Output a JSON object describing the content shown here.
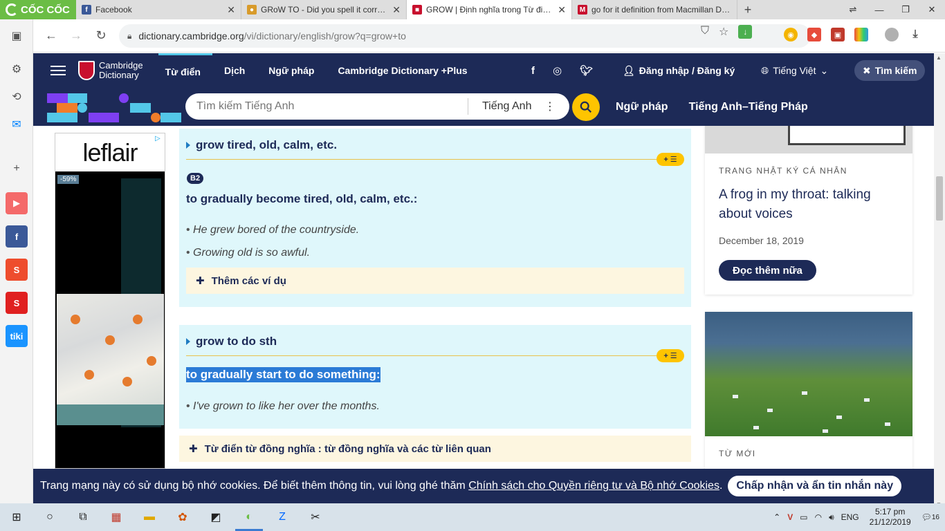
{
  "browser": {
    "brand": "CỐC CỐC",
    "tabs": [
      {
        "title": "Facebook",
        "close": "✕",
        "fav_color": "#3b5998",
        "fav_glyph": "f"
      },
      {
        "title": "GRoW TO - Did you spell it correctly?",
        "close": "✕",
        "fav_color": "#d89b2b",
        "fav_glyph": "●"
      },
      {
        "title": "GROW | Định nghĩa trong Từ điển tiếng Anh Cambridge",
        "close": "✕",
        "fav_color": "#c8102e",
        "fav_glyph": "■"
      },
      {
        "title": "go for it definition from Macmillan Dictionary",
        "close": "",
        "fav_color": "#c8102e",
        "fav_glyph": "M"
      }
    ],
    "new_tab": "+",
    "url_host": "dictionary.cambridge.org",
    "url_path": "/vi/dictionary/english/grow?q=grow+to"
  },
  "header": {
    "logo_line1": "Cambridge",
    "logo_line2": "Dictionary",
    "nav": [
      "Từ điển",
      "Dịch",
      "Ngữ pháp",
      "Cambridge Dictionary +Plus"
    ],
    "login": "Đăng nhập / Đăng ký",
    "language": "Tiếng Việt",
    "search_button": "Tìm kiếm"
  },
  "search": {
    "placeholder": "Tìm kiếm Tiếng Anh",
    "lang": "Tiếng Anh",
    "links": [
      "Ngữ pháp",
      "Tiếng Anh–Tiếng Pháp"
    ]
  },
  "ad": {
    "brand": "leflair",
    "badge": "-59%"
  },
  "senses": [
    {
      "guideword": "grow tired, old, calm, etc.",
      "level": "B2",
      "definition": "to gradually become tired, old, calm, etc.:",
      "examples": [
        "He grew bored of the countryside.",
        "Growing old is so awful."
      ],
      "more": "Thêm các ví dụ"
    },
    {
      "guideword": "grow to do sth",
      "definition": "to gradually start to do something:",
      "examples": [
        "I've grown to like her over the months."
      ]
    }
  ],
  "plus_list_label": "+ ☰",
  "thesaurus": "Từ điển từ đồng nghĩa : từ đồng nghĩa và các từ liên quan",
  "sidebar_cards": [
    {
      "kicker": "TRANG NHẬT KÝ CÁ NHÂN",
      "title": "A frog in my throat: talking about voices",
      "date": "December 18, 2019",
      "button": "Đọc thêm nữa"
    },
    {
      "kicker": "TỪ MỚI"
    }
  ],
  "cookie": {
    "text": "Trang mạng này có sử dụng bộ nhớ cookies. Để biết thêm thông tin, vui lòng ghé thăm ",
    "link": "Chính sách cho Quyền riêng tư và Bộ nhớ Cookies",
    "end": ".",
    "accept": "Chấp nhận và ẩn tin nhắn này"
  },
  "taskbar": {
    "lang": "ENG",
    "time": "5:17 pm",
    "date": "21/12/2019",
    "notif": "16"
  },
  "colors": {
    "cambridge_navy": "#1d2a57",
    "sense_bg": "#dff7fb",
    "accent_yellow": "#fec400",
    "highlight": "#2b7bd6"
  }
}
